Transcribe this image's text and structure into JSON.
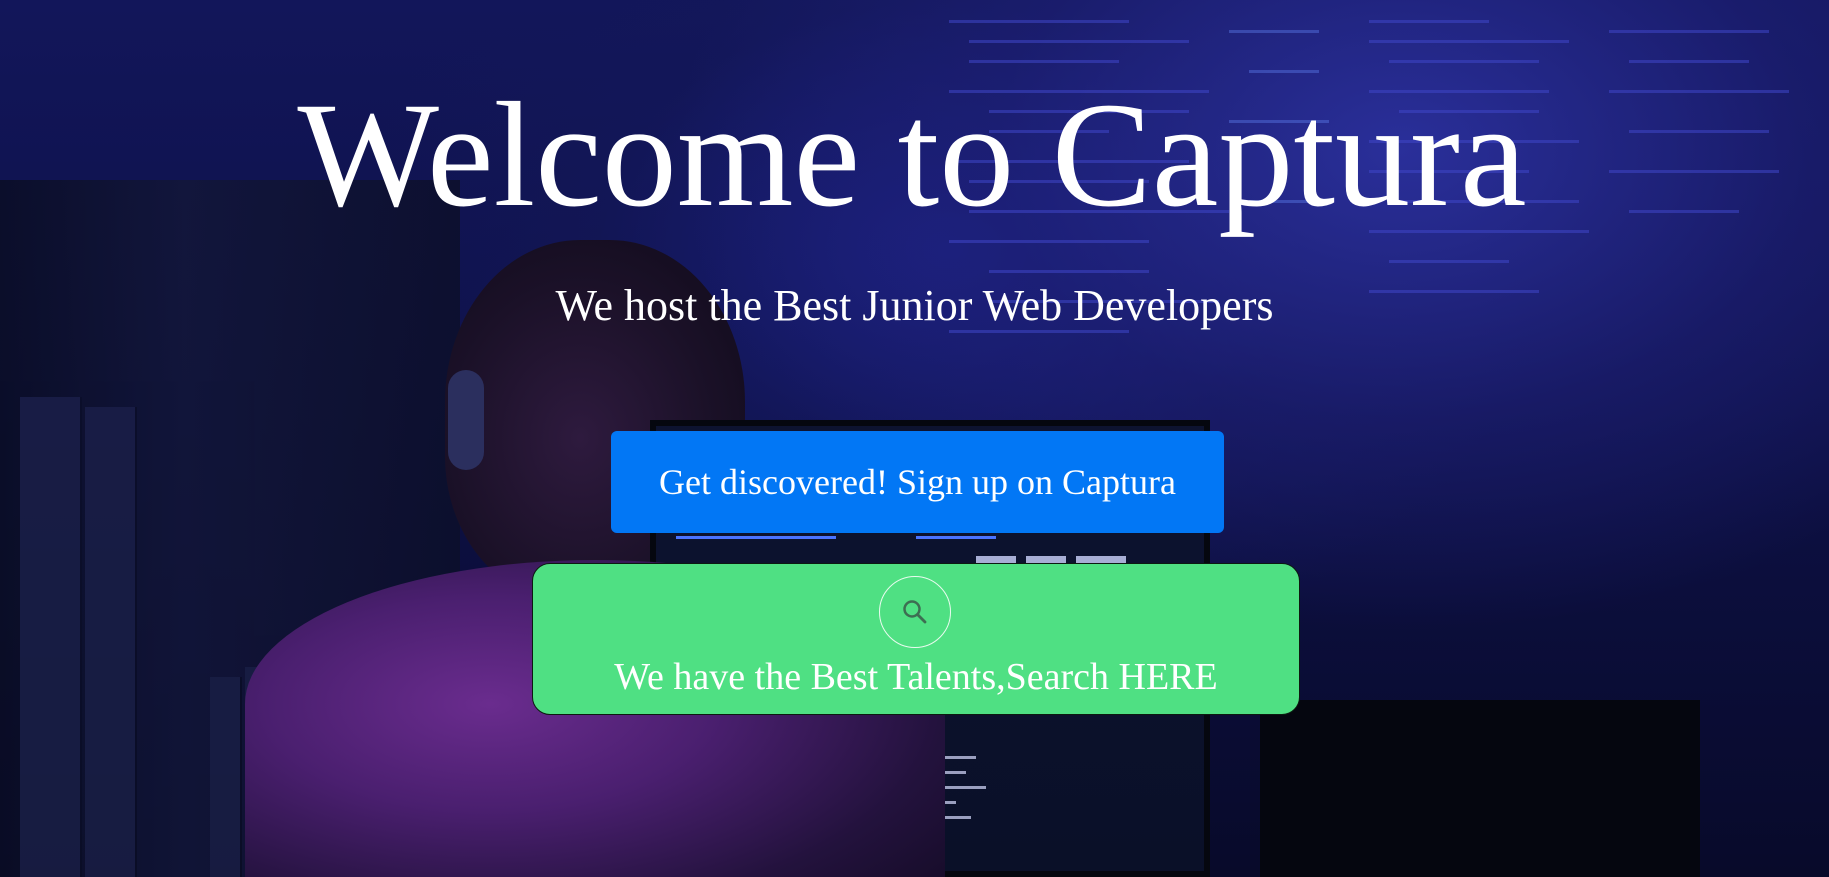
{
  "hero": {
    "title": "Welcome to Captura",
    "subtitle": "We host the Best Junior Web Developers"
  },
  "signup": {
    "label": "Get discovered! Sign up on Captura",
    "color": "#0277f5"
  },
  "search": {
    "label": "We have the Best Talents,Search HERE",
    "icon": "search-icon",
    "color": "#4fe083"
  }
}
